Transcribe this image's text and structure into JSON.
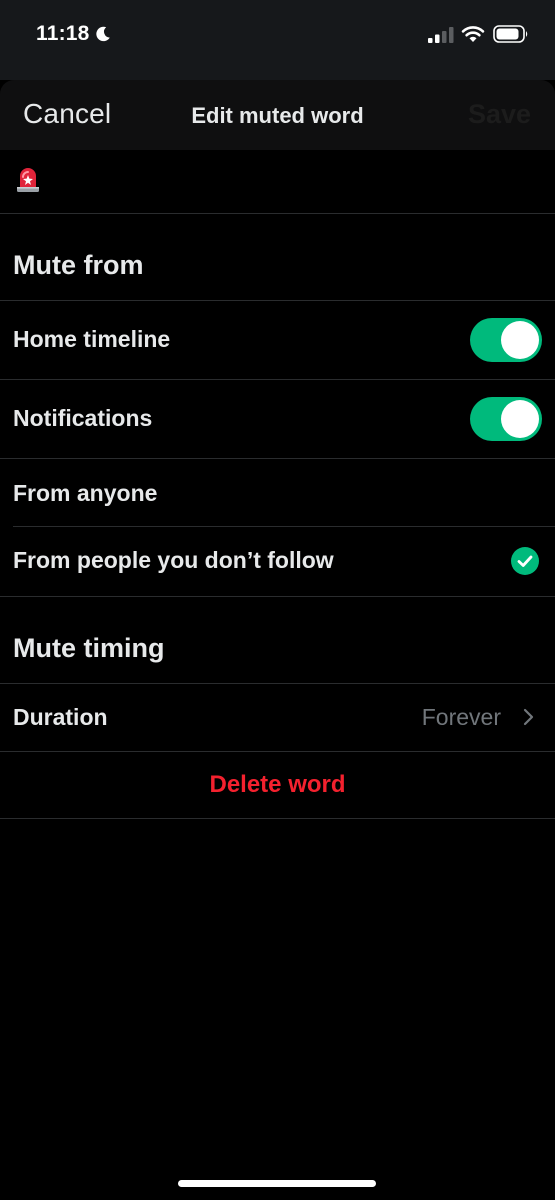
{
  "status_bar": {
    "time": "11:18",
    "icons": [
      "moon-icon",
      "signal-icon",
      "wifi-icon",
      "battery-icon"
    ]
  },
  "nav": {
    "cancel_label": "Cancel",
    "title": "Edit muted word",
    "save_label": "Save"
  },
  "muted_word": {
    "value_icon": "police-car-light-emoji"
  },
  "mute_from": {
    "title": "Mute from",
    "home_timeline": {
      "label": "Home timeline",
      "enabled": true
    },
    "notifications": {
      "label": "Notifications",
      "enabled": true
    },
    "from_anyone": {
      "label": "From anyone",
      "selected": false
    },
    "from_not_following": {
      "label": "From people you don’t follow",
      "selected": true
    }
  },
  "mute_timing": {
    "title": "Mute timing",
    "duration_label": "Duration",
    "duration_value": "Forever"
  },
  "delete_label": "Delete word",
  "colors": {
    "accent_green": "#00ba7c",
    "danger_red": "#f4212e",
    "background": "#000000",
    "secondary_text": "#71767b"
  }
}
